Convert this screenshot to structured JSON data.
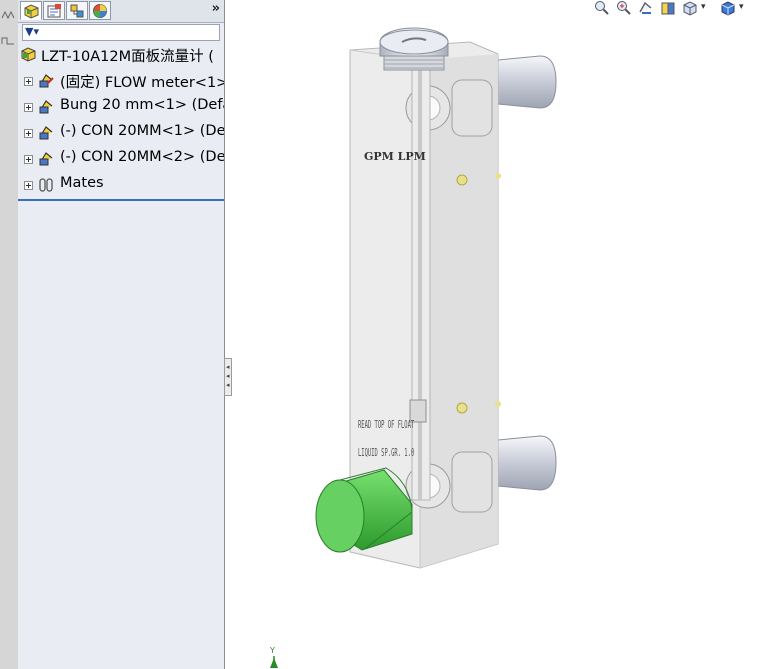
{
  "feature_manager": {
    "tabs": [
      {
        "name": "featuremanager-tree-tab",
        "icon": "part-tree-icon"
      },
      {
        "name": "propertymanager-tab",
        "icon": "property-icon"
      },
      {
        "name": "configurationmanager-tab",
        "icon": "configuration-icon"
      },
      {
        "name": "displaymanager-tab",
        "icon": "appearance-icon"
      }
    ],
    "more_label": "»",
    "filter_icon": "funnel-icon",
    "root": {
      "label": "LZT-10A12M面板流量计  (",
      "icon": "assembly-icon"
    },
    "items": [
      {
        "label": "(固定) FLOW meter<1>",
        "icon": "part-icon"
      },
      {
        "label": "Bung 20 mm<1> (Defa",
        "icon": "part-icon"
      },
      {
        "label": "(-) CON 20MM<1> (De",
        "icon": "part-icon"
      },
      {
        "label": "(-) CON 20MM<2> (De",
        "icon": "part-icon"
      },
      {
        "label": "Mates",
        "icon": "mates-icon"
      }
    ]
  },
  "heads_up_toolbar": {
    "icons": [
      "zoom-to-fit-icon",
      "zoom-to-area-icon",
      "previous-view-icon",
      "section-view-icon",
      "view-orientation-icon",
      "display-style-icon"
    ]
  },
  "model_labels": {
    "scale_label": "GPM  LPM",
    "read_label_1": "READ TOP OF FLOAT",
    "read_label_2": "LIQUID SP.GR. 1.0"
  },
  "triad": {
    "axis_label": "Y"
  },
  "colors": {
    "panel_bg": "#e9ecf3",
    "accent_line": "#3a6fc0",
    "bung_green": "#5cc85c"
  }
}
